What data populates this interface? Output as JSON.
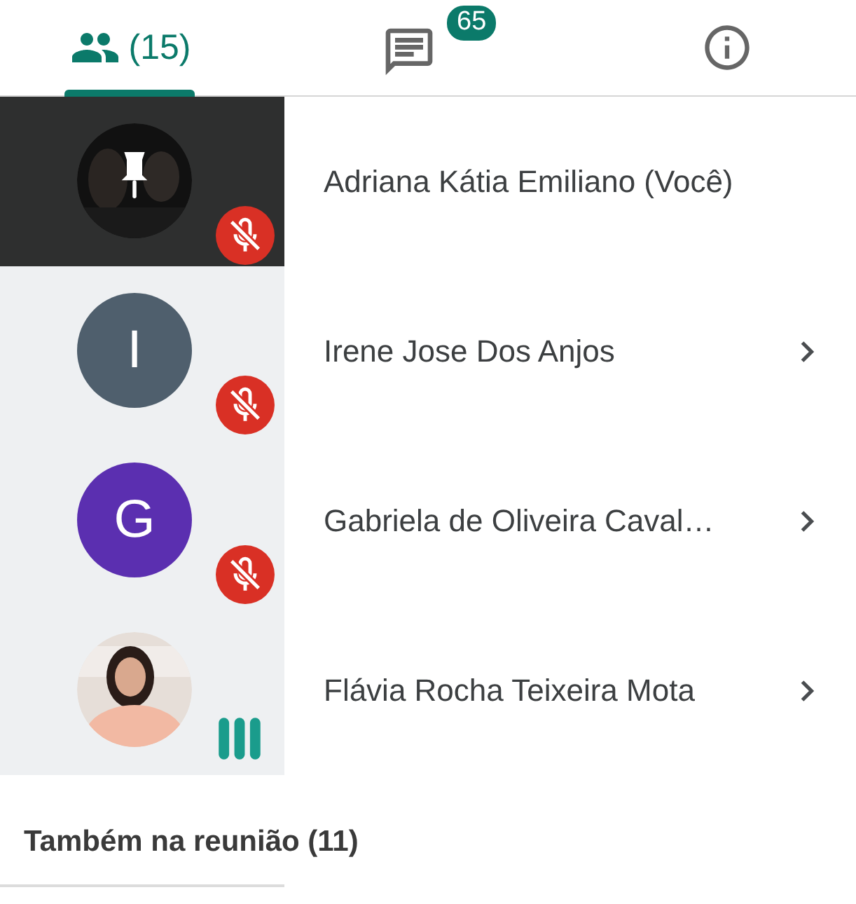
{
  "tabs": [
    {
      "kind": "people",
      "label": "(15)",
      "selected": true
    },
    {
      "kind": "chat",
      "badge": "65",
      "selected": false
    },
    {
      "kind": "info",
      "selected": false
    }
  ],
  "participants": [
    {
      "name": "Adriana Kátia Emiliano (Você)",
      "pinned": true,
      "muted": true,
      "expandable": false
    },
    {
      "name": "Irene Jose Dos Anjos",
      "avatar": {
        "kind": "letter",
        "letter": "I",
        "color": "#4f5f6d"
      },
      "pinned": false,
      "muted": true,
      "expandable": true
    },
    {
      "name": "Gabriela de Oliveira Caval…",
      "avatar": {
        "kind": "letter",
        "letter": "G",
        "color": "#5b2fb0"
      },
      "pinned": false,
      "muted": true,
      "expandable": true
    },
    {
      "name": "Flávia Rocha Teixeira Mota",
      "pinned": false,
      "muted": false,
      "expandable": true
    }
  ],
  "section": {
    "title": "Também na reunião (11)"
  }
}
